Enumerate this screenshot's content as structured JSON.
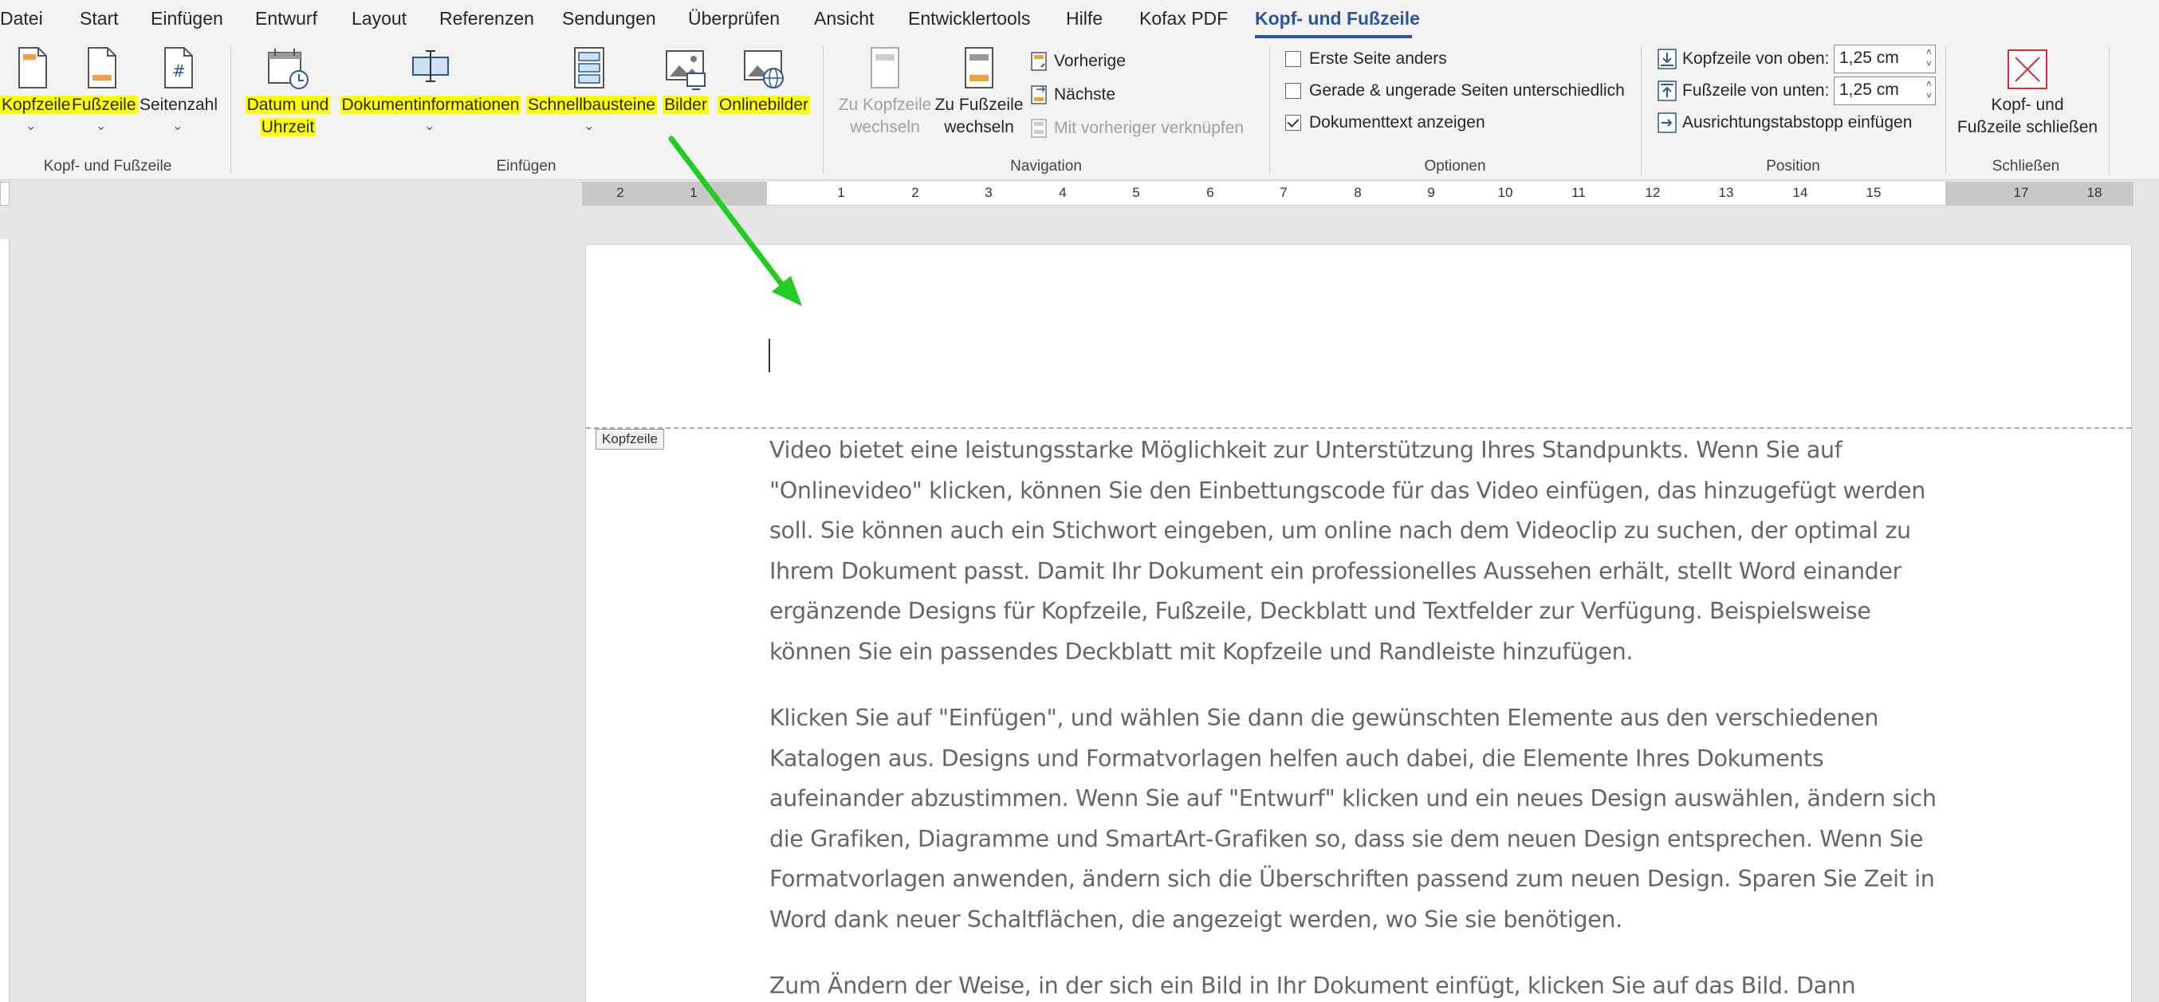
{
  "menu": {
    "tabs": [
      "Datei",
      "Start",
      "Einfügen",
      "Entwurf",
      "Layout",
      "Referenzen",
      "Sendungen",
      "Überprüfen",
      "Ansicht",
      "Entwicklertools",
      "Hilfe",
      "Kofax PDF",
      "Kopf- und Fußzeile"
    ],
    "active": "Kopf- und Fußzeile"
  },
  "ribbon": {
    "group_kopf": {
      "label": "Kopf- und Fußzeile",
      "kopfzeile": "Kopfzeile",
      "fusszeile": "Fußzeile",
      "seitenzahl": "Seitenzahl"
    },
    "group_einfuegen": {
      "label": "Einfügen",
      "datum_line1": "Datum und",
      "datum_line2": "Uhrzeit",
      "dokinfo": "Dokumentinformationen",
      "schnell": "Schnellbausteine",
      "bilder": "Bilder",
      "onlinebilder": "Onlinebilder"
    },
    "group_navigation": {
      "label": "Navigation",
      "zu_kopf_line1": "Zu Kopfzeile",
      "zu_kopf_line2": "wechseln",
      "zu_fuss_line1": "Zu Fußzeile",
      "zu_fuss_line2": "wechseln",
      "vorherige": "Vorherige",
      "naechste": "Nächste",
      "verknuepfen": "Mit vorheriger verknüpfen"
    },
    "group_optionen": {
      "label": "Optionen",
      "erste_seite": "Erste Seite anders",
      "gerade": "Gerade & ungerade Seiten unterschiedlich",
      "dokumenttext": "Dokumenttext anzeigen",
      "erste_seite_checked": false,
      "gerade_checked": false,
      "dokumenttext_checked": true
    },
    "group_position": {
      "label": "Position",
      "kopf_oben": "Kopfzeile von oben:",
      "kopf_oben_value": "1,25 cm",
      "fuss_unten": "Fußzeile von unten:",
      "fuss_unten_value": "1,25 cm",
      "ausrichtung": "Ausrichtungstabstopp einfügen"
    },
    "group_schliessen": {
      "label": "Schließen",
      "close_line1": "Kopf- und",
      "close_line2": "Fußzeile schließen"
    }
  },
  "ruler": {
    "ticks": [
      "2",
      "1",
      "1",
      "2",
      "3",
      "4",
      "5",
      "6",
      "7",
      "8",
      "9",
      "10",
      "11",
      "12",
      "13",
      "14",
      "15",
      "17",
      "18"
    ]
  },
  "document": {
    "header_tag": "Kopfzeile",
    "paragraphs": [
      "Video bietet eine leistungsstarke Möglichkeit zur Unterstützung Ihres Standpunkts. Wenn Sie auf \"Onlinevideo\" klicken, können Sie den Einbettungscode für das Video einfügen, das hinzugefügt werden soll. Sie können auch ein Stichwort eingeben, um online nach dem Videoclip zu suchen, der optimal zu Ihrem Dokument passt. Damit Ihr Dokument ein professionelles Aussehen erhält, stellt Word einander ergänzende Designs für Kopfzeile, Fußzeile, Deckblatt und Textfelder zur Verfügung. Beispielsweise können Sie ein passendes Deckblatt mit Kopfzeile und Randleiste hinzufügen.",
      "Klicken Sie auf \"Einfügen\", und wählen Sie dann die gewünschten Elemente aus den verschiedenen Katalogen aus. Designs und Formatvorlagen helfen auch dabei, die Elemente Ihres Dokuments aufeinander abzustimmen. Wenn Sie auf \"Entwurf\" klicken und ein neues Design auswählen, ändern sich die Grafiken, Diagramme und SmartArt-Grafiken so, dass sie dem neuen Design entsprechen. Wenn Sie Formatvorlagen anwenden, ändern sich die Überschriften passend zum neuen Design. Sparen Sie Zeit in Word dank neuer Schaltflächen, die angezeigt werden, wo Sie sie benötigen.",
      "Zum Ändern der Weise, in der sich ein Bild in Ihr Dokument einfügt, klicken Sie auf das Bild. Dann"
    ]
  },
  "colors": {
    "accent": "#2b579a",
    "highlight": "#ffff00",
    "arrow": "#22cc22",
    "body_text": "#666666"
  }
}
